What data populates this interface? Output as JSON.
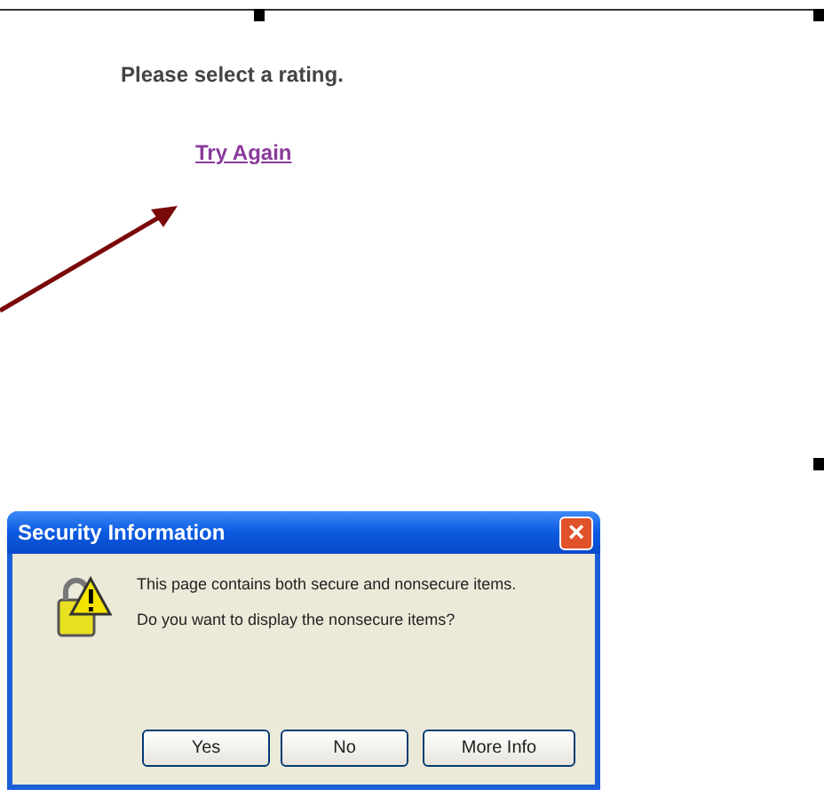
{
  "page": {
    "message": "Please select a rating.",
    "link": "Try Again"
  },
  "dialog": {
    "title": "Security Information",
    "close": "×",
    "message": "This page contains both secure and nonsecure items.",
    "question": "Do you want to display the nonsecure items?",
    "buttons": [
      "Yes",
      "No",
      "More Info"
    ]
  }
}
